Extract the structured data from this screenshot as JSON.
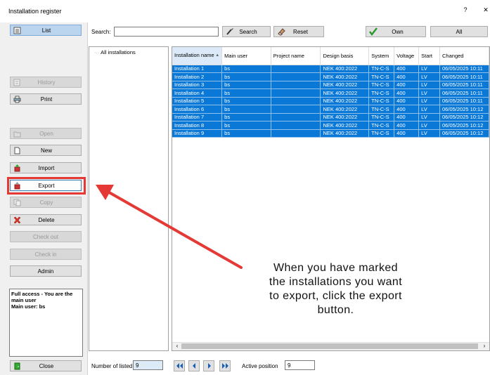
{
  "window": {
    "title": "Installation register",
    "help_label": "?",
    "close_label": "✕"
  },
  "sidebar": {
    "list_label": "List",
    "history_label": "History",
    "print_label": "Print",
    "open_label": "Open",
    "new_label": "New",
    "import_label": "Import",
    "export_label": "Export",
    "copy_label": "Copy",
    "delete_label": "Delete",
    "checkout_label": "Check out",
    "checkin_label": "Check in",
    "admin_label": "Admin",
    "close_label": "Close",
    "status_line1": "Full access - You are the main user",
    "status_line2": "Main user: bs"
  },
  "toolbar": {
    "search_label": "Search:",
    "search_value": "",
    "search_button": "Search",
    "reset_button": "Reset",
    "own_button": "Own",
    "all_button": "All"
  },
  "tree": {
    "root_label": "All installations"
  },
  "grid": {
    "columns": [
      "Installation name",
      "Main user",
      "Project name",
      "Design basis",
      "System",
      "Voltage",
      "Start",
      "Changed"
    ],
    "rows": [
      [
        "Installation 1",
        "bs",
        "",
        "NEK 400:2022",
        "TN-C-S",
        "400",
        "LV",
        "06/05/2025 10:11"
      ],
      [
        "Installation 2",
        "bs",
        "",
        "NEK 400:2022",
        "TN-C-S",
        "400",
        "LV",
        "06/05/2025 10:11"
      ],
      [
        "Installation 3",
        "bs",
        "",
        "NEK 400:2022",
        "TN-C-S",
        "400",
        "LV",
        "06/05/2025 10:11"
      ],
      [
        "Installation 4",
        "bs",
        "",
        "NEK 400:2022",
        "TN-C-S",
        "400",
        "LV",
        "06/05/2025 10:11"
      ],
      [
        "Installation 5",
        "bs",
        "",
        "NEK 400:2022",
        "TN-C-S",
        "400",
        "LV",
        "06/05/2025 10:11"
      ],
      [
        "Installation 6",
        "bs",
        "",
        "NEK 400:2022",
        "TN-C-S",
        "400",
        "LV",
        "06/05/2025 10:12"
      ],
      [
        "Installation 7",
        "bs",
        "",
        "NEK 400:2022",
        "TN-C-S",
        "400",
        "LV",
        "06/05/2025 10:12"
      ],
      [
        "Installation 8",
        "bs",
        "",
        "NEK 400:2022",
        "TN-C-S",
        "400",
        "LV",
        "06/05/2025 10:12"
      ],
      [
        "Installation 9",
        "bs",
        "",
        "NEK 400:2022",
        "TN-C-S",
        "400",
        "LV",
        "06/05/2025 10:12"
      ]
    ],
    "selected_row_color": "#0a78d7"
  },
  "callout": {
    "line1": "When you have marked",
    "line2": "the installations you want",
    "line3": "to export, click the export",
    "line4": "button.",
    "arrow_color": "#e53935"
  },
  "footer": {
    "listed_label": "Number of listed",
    "listed_value": "9",
    "active_label": "Active position",
    "active_value": "9"
  },
  "icons": {
    "list": "list-icon",
    "history": "history-icon",
    "print": "printer-icon",
    "open": "folder-open-icon",
    "new": "new-document-icon",
    "import": "import-icon",
    "export": "export-icon",
    "copy": "copy-icon",
    "delete": "delete-x-icon",
    "close": "exit-door-icon",
    "search": "search-brush-icon",
    "reset": "reset-eraser-icon",
    "own": "checkmark-icon",
    "nav": [
      "first-icon",
      "previous-icon",
      "next-icon",
      "last-icon"
    ]
  }
}
